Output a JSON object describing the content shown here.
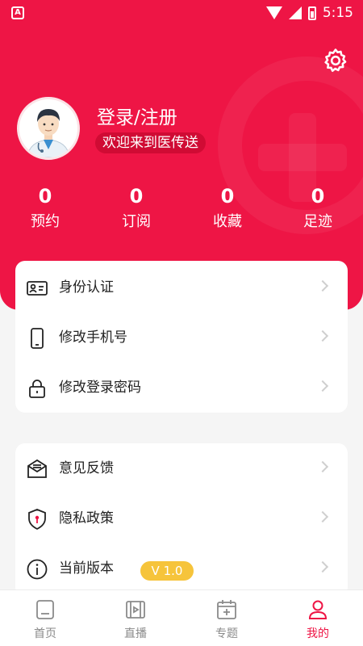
{
  "statusbar": {
    "app_icon": "A",
    "time": "5:15"
  },
  "profile": {
    "login_label": "登录/注册",
    "welcome": "欢迎来到医传送"
  },
  "stats": [
    {
      "value": "0",
      "label": "预约"
    },
    {
      "value": "0",
      "label": "订阅"
    },
    {
      "value": "0",
      "label": "收藏"
    },
    {
      "value": "0",
      "label": "足迹"
    }
  ],
  "account_menu": [
    {
      "label": "身份认证",
      "icon": "id-card-icon"
    },
    {
      "label": "修改手机号",
      "icon": "phone-icon"
    },
    {
      "label": "修改登录密码",
      "icon": "lock-icon"
    }
  ],
  "about_menu": [
    {
      "label": "意见反馈",
      "icon": "feedback-icon"
    },
    {
      "label": "隐私政策",
      "icon": "shield-lock-icon"
    },
    {
      "label": "当前版本",
      "icon": "info-icon",
      "badge": "V 1.0"
    }
  ],
  "tabbar": [
    {
      "label": "首页",
      "icon": "home-icon",
      "active": false
    },
    {
      "label": "直播",
      "icon": "live-icon",
      "active": false
    },
    {
      "label": "专题",
      "icon": "calendar-plus-icon",
      "active": false
    },
    {
      "label": "我的",
      "icon": "user-icon",
      "active": true
    }
  ],
  "colors": {
    "brand": "#ee1545",
    "badge": "#f6c43b",
    "muted": "#8a8a8a"
  }
}
